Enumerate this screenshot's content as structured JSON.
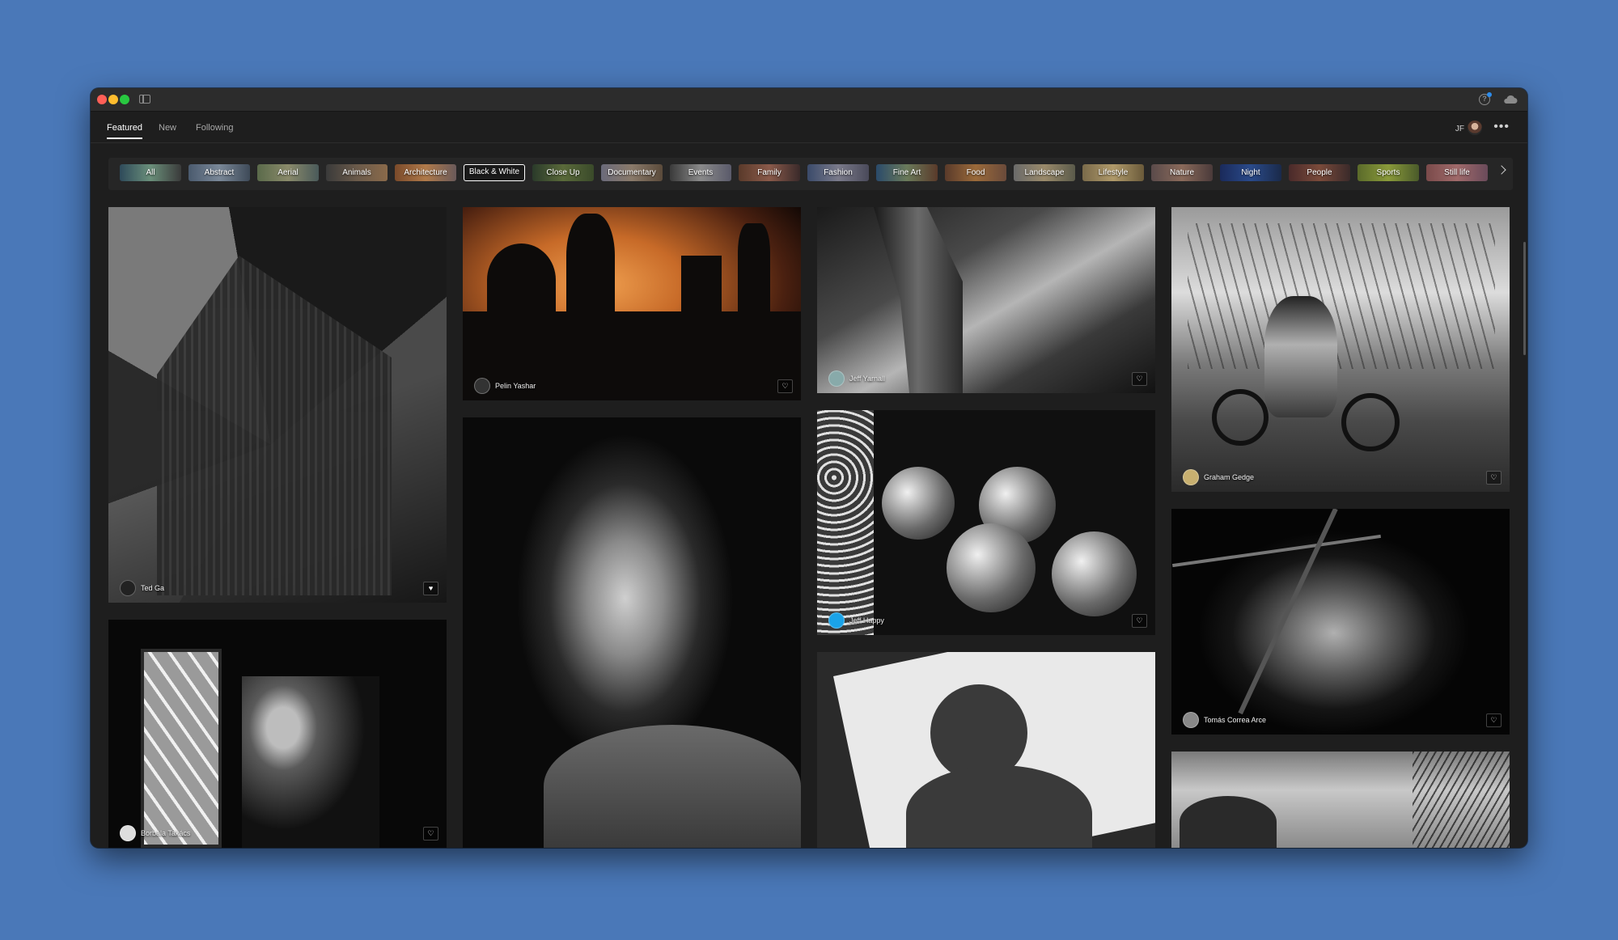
{
  "tabs": [
    {
      "label": "Featured",
      "active": true
    },
    {
      "label": "New",
      "active": false
    },
    {
      "label": "Following",
      "active": false
    }
  ],
  "user": {
    "initials": "JF"
  },
  "categories": [
    {
      "label": "All",
      "selected": false
    },
    {
      "label": "Abstract",
      "selected": false
    },
    {
      "label": "Aerial",
      "selected": false
    },
    {
      "label": "Animals",
      "selected": false
    },
    {
      "label": "Architecture",
      "selected": false
    },
    {
      "label": "Black & White",
      "selected": true
    },
    {
      "label": "Close Up",
      "selected": false
    },
    {
      "label": "Documentary",
      "selected": false
    },
    {
      "label": "Events",
      "selected": false
    },
    {
      "label": "Family",
      "selected": false
    },
    {
      "label": "Fashion",
      "selected": false
    },
    {
      "label": "Fine Art",
      "selected": false
    },
    {
      "label": "Food",
      "selected": false
    },
    {
      "label": "Landscape",
      "selected": false
    },
    {
      "label": "Lifestyle",
      "selected": false
    },
    {
      "label": "Nature",
      "selected": false
    },
    {
      "label": "Night",
      "selected": false
    },
    {
      "label": "People",
      "selected": false
    },
    {
      "label": "Sports",
      "selected": false
    },
    {
      "label": "Still life",
      "selected": false
    }
  ],
  "photos": [
    {
      "author": "Ted Ga",
      "liked": true
    },
    {
      "author": "Borbála Takács",
      "liked": false
    },
    {
      "author": "Pelin Yashar",
      "liked": false
    },
    {
      "author": "",
      "liked": false
    },
    {
      "author": "Jeff Yarnall",
      "liked": false
    },
    {
      "author": "Jeff Happy",
      "liked": false
    },
    {
      "author": "",
      "liked": false
    },
    {
      "author": "Graham Gedge",
      "liked": false
    },
    {
      "author": "Tomás Correa Arce",
      "liked": false
    },
    {
      "author": "",
      "liked": false
    }
  ],
  "colors": {
    "desktop": "#4a78b8",
    "window_bg": "#1e1e1e",
    "titlebar": "#2c2c2c",
    "selected_border": "#ffffff"
  }
}
